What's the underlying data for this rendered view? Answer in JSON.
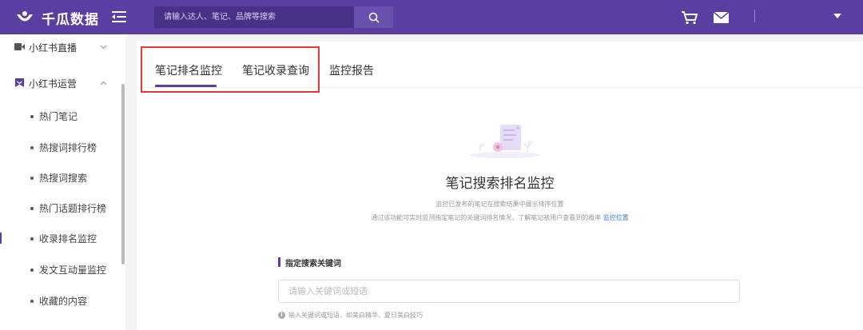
{
  "header": {
    "brand": "千瓜数据",
    "search": {
      "placeholder": "请输入达人、笔记、品牌等搜索"
    },
    "colors": {
      "bar": "#5b3ea1",
      "accent": "#3d7ce6",
      "highlight": "#e53935"
    }
  },
  "sidebar": {
    "groups": [
      {
        "label": "小红书直播",
        "icon": "video-icon",
        "expanded": false
      },
      {
        "label": "小红书运营",
        "icon": "bookmark-icon",
        "expanded": true
      }
    ],
    "items": [
      {
        "label": "热门笔记"
      },
      {
        "label": "热搜词排行榜"
      },
      {
        "label": "热搜词搜索"
      },
      {
        "label": "热门话题排行榜"
      },
      {
        "label": "收录排名监控",
        "active": true
      },
      {
        "label": "发文互动量监控"
      },
      {
        "label": "收藏的内容"
      }
    ]
  },
  "main": {
    "tabs": [
      {
        "label": "笔记排名监控",
        "active": true
      },
      {
        "label": "笔记收录查询"
      },
      {
        "label": "监控报告"
      }
    ],
    "hero": {
      "title": "笔记搜索排名监控",
      "sub1": "监控已发布的笔记在搜索结果中展示排序位置",
      "sub2": "通过该功能可实时监测指定笔记的关键词排名情况，了解笔记被用户查看到的概率",
      "link": "监控位置"
    },
    "keyword": {
      "title": "指定搜索关键词",
      "placeholder": "请输入关键词或短语",
      "hint": "输入关键词或短语，如美白精华、夏日美白技巧"
    }
  }
}
